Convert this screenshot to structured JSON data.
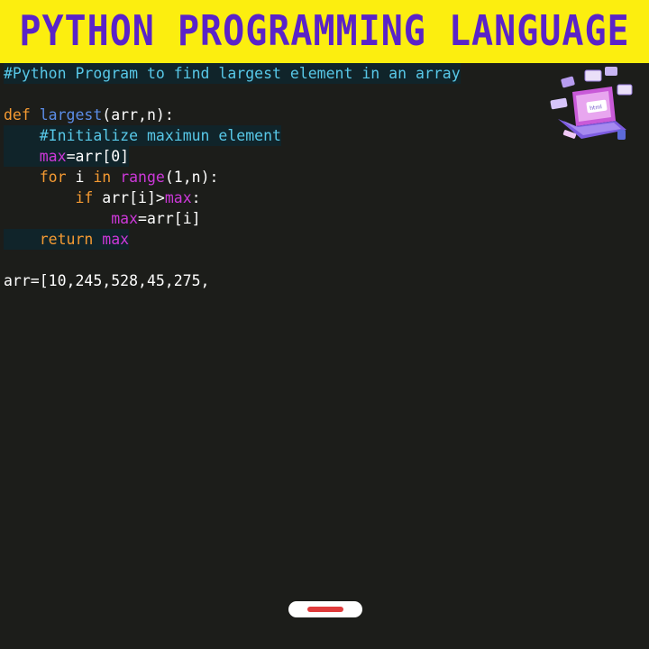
{
  "banner": {
    "title": "PYTHON PROGRAMMING LANGUAGE"
  },
  "code": {
    "lines": [
      {
        "id": "l1",
        "tokens": [
          {
            "t": "#Python Program to find largest element in an array",
            "k": "comment"
          }
        ]
      },
      {
        "id": "l2",
        "tokens": []
      },
      {
        "id": "l3",
        "tokens": [
          {
            "t": "def ",
            "k": "kw"
          },
          {
            "t": "largest",
            "k": "fn"
          },
          {
            "t": "(arr,n):",
            "k": "text"
          }
        ]
      },
      {
        "id": "l4",
        "indent": "    ",
        "tokens": [
          {
            "t": "#Initialize maximun element",
            "k": "comment"
          }
        ]
      },
      {
        "id": "l5",
        "indent": "    ",
        "tokens": [
          {
            "t": "max",
            "k": "var"
          },
          {
            "t": "=arr[0]",
            "k": "text"
          }
        ]
      },
      {
        "id": "l6",
        "indent": "    ",
        "tokens": [
          {
            "t": "for ",
            "k": "kw"
          },
          {
            "t": "i ",
            "k": "text"
          },
          {
            "t": "in ",
            "k": "kw"
          },
          {
            "t": "range",
            "k": "var"
          },
          {
            "t": "(1,n):",
            "k": "text"
          }
        ]
      },
      {
        "id": "l7",
        "indent": "        ",
        "tokens": [
          {
            "t": "if ",
            "k": "kw"
          },
          {
            "t": "arr[i]>",
            "k": "text"
          },
          {
            "t": "max",
            "k": "var"
          },
          {
            "t": ":",
            "k": "text"
          }
        ]
      },
      {
        "id": "l8",
        "indent": "            ",
        "tokens": [
          {
            "t": "max",
            "k": "var"
          },
          {
            "t": "=arr[i]",
            "k": "text"
          }
        ]
      },
      {
        "id": "l9",
        "indent": "    ",
        "tokens": [
          {
            "t": "return ",
            "k": "kw"
          },
          {
            "t": "max",
            "k": "var"
          }
        ]
      },
      {
        "id": "l10",
        "tokens": []
      },
      {
        "id": "l11",
        "tokens": [
          {
            "t": "arr=[10,245,528,45,275,",
            "k": "text"
          }
        ]
      }
    ]
  },
  "colors": {
    "banner_bg": "#fcee0f",
    "banner_text": "#5a23c8",
    "background": "#1c1d1a",
    "comment": "#58c8e8",
    "keyword": "#f59a32",
    "function": "#5b8de8",
    "variable": "#cc38d8",
    "text": "#ffffff"
  },
  "illustration": {
    "icon": "laptop-code-illustration-icon",
    "label": "html"
  }
}
